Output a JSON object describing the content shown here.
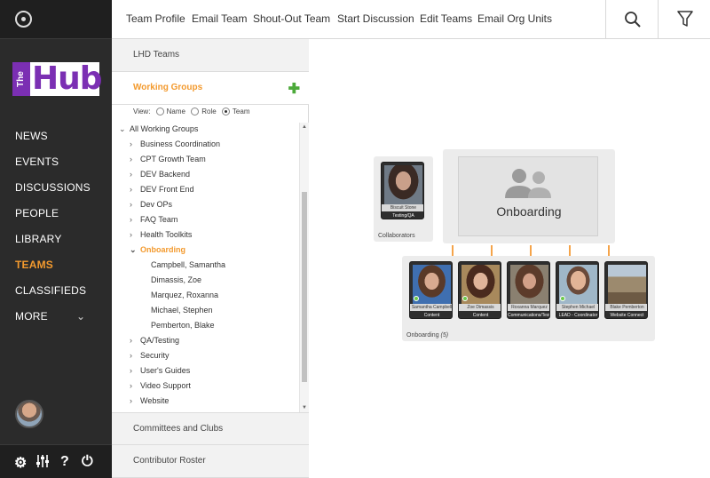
{
  "sidebar": {
    "logo": {
      "the": "The",
      "hub": "Hub"
    },
    "items": [
      {
        "label": "NEWS"
      },
      {
        "label": "EVENTS"
      },
      {
        "label": "DISCUSSIONS"
      },
      {
        "label": "PEOPLE"
      },
      {
        "label": "LIBRARY"
      },
      {
        "label": "TEAMS",
        "active": true
      },
      {
        "label": "CLASSIFIEDS"
      },
      {
        "label": "MORE"
      }
    ],
    "bottom_icons": [
      "gear-icon",
      "sliders-icon",
      "help-icon",
      "power-icon"
    ]
  },
  "topbar": {
    "links": [
      "Team Profile",
      "Email Team",
      "Shout-Out Team",
      "Start Discussion",
      "Edit Teams",
      "Email Org Units"
    ],
    "icons": [
      "search-icon",
      "filter-icon"
    ]
  },
  "panel": {
    "section_lhd": "LHD Teams",
    "section_working": "Working Groups",
    "view": {
      "label": "View:",
      "options": [
        "Name",
        "Role",
        "Team"
      ],
      "selected": "Team"
    },
    "tree": {
      "root": "All Working Groups",
      "items": [
        "Business Coordination",
        "CPT Growth Team",
        "DEV Backend",
        "DEV Front End",
        "Dev OPs",
        "FAQ Team",
        "Health Toolkits",
        "Onboarding",
        "QA/Testing",
        "Security",
        "User's Guides",
        "Video Support",
        "Website"
      ],
      "selected": "Onboarding",
      "onboarding_members": [
        "Campbell, Samantha",
        "Dimassis, Zoe",
        "Marquez, Roxanna",
        "Michael, Stephen",
        "Pemberton, Blake"
      ]
    },
    "section_committees": "Committees and Clubs",
    "section_roster": "Contributor Roster"
  },
  "canvas": {
    "collaborators": {
      "caption": "Collaborators",
      "card": {
        "name": "Biscuit Stone",
        "role": "Testing/QA"
      }
    },
    "team": {
      "title": "Onboarding"
    },
    "members_caption": "Onboarding",
    "members_count": "(5)",
    "members": [
      {
        "name": "Samantha Campbell",
        "role": "Content"
      },
      {
        "name": "Zoe Dimassis",
        "role": "Content"
      },
      {
        "name": "Roxanna Marquez",
        "role": "Communications/Testi..."
      },
      {
        "name": "Stephen Michael",
        "role": "LEAD - Coordinator"
      },
      {
        "name": "Blake Pemberton",
        "role": "Website Connect"
      }
    ]
  },
  "colors": {
    "accent": "#f39a2e",
    "brand": "#7b2fb3",
    "add": "#4caa3a"
  }
}
